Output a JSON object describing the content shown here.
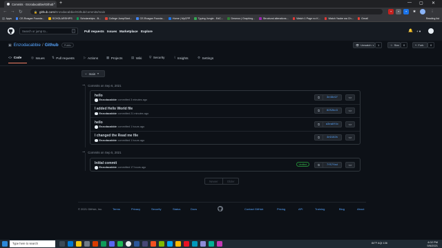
{
  "browser": {
    "tab_title": "Commits · Enzodacabbie/Github",
    "new_tab": "+",
    "url_host": "github.com",
    "url_path": "/Enzodacabbie/Github/commits/main",
    "window_controls": {
      "minimize": "—",
      "maximize": "▢",
      "close": "✕"
    },
    "bookmarks": [
      {
        "label": "Apps",
        "color": "#5f6368"
      },
      {
        "label": "CE-Roagan Founda...",
        "color": "#4285f4"
      },
      {
        "label": "SCHOLARSHIPS",
        "color": "#f4b400"
      },
      {
        "label": "Scholarships - B...",
        "color": "#0f9d58"
      },
      {
        "label": "College JumpStart...",
        "color": "#db4437"
      },
      {
        "label": "CE-Roagan Founda...",
        "color": "#4285f4"
      },
      {
        "label": "Home | MyCPP",
        "color": "#1a73e8"
      },
      {
        "label": "Typing Jungle - EdC...",
        "color": "#34a853"
      },
      {
        "label": "Desmos | Graphing...",
        "color": "#2e7d32"
      },
      {
        "label": "Structural alterations...",
        "color": "#9c27b0"
      },
      {
        "label": "Watch 1 Page no K...",
        "color": "#e53935"
      },
      {
        "label": "Watch Yaube wa Ch...",
        "color": "#e53935"
      },
      {
        "label": "Gmail",
        "color": "#ea4335"
      }
    ],
    "reading_list": "Reading list"
  },
  "github_header": {
    "search_placeholder": "Search or jump to...",
    "search_shortcut": "/",
    "nav": [
      "Pull requests",
      "Issues",
      "Marketplace",
      "Explore"
    ],
    "bell": "🔔",
    "plus": "+ ▾"
  },
  "repo": {
    "owner": "Enzodacabbie",
    "separator": "/",
    "name": "Github",
    "visibility": "Public",
    "unwatch_label": "Unwatch",
    "unwatch_count": "1",
    "star_label": "Star",
    "star_count": "0",
    "fork_label": "Fork",
    "fork_count": "0",
    "tabs": [
      {
        "label": "Code",
        "icon": "<>"
      },
      {
        "label": "Issues",
        "icon": "◎"
      },
      {
        "label": "Pull requests",
        "icon": "⇅"
      },
      {
        "label": "Actions",
        "icon": "▷"
      },
      {
        "label": "Projects",
        "icon": "▦"
      },
      {
        "label": "Wiki",
        "icon": "▤"
      },
      {
        "label": "Security",
        "icon": "⛨"
      },
      {
        "label": "Insights",
        "icon": "⌇"
      },
      {
        "label": "Settings",
        "icon": "⚙"
      }
    ]
  },
  "branch": {
    "label": "main",
    "icon": "⑂",
    "caret": "▾"
  },
  "commit_groups": [
    {
      "heading": "Commits on Sep 6, 2021",
      "commits": [
        {
          "message": "hello",
          "author": "Enzodacabbie",
          "time": "committed 3 minutes ago",
          "sha": "3e48c97",
          "verified": ""
        },
        {
          "message": "I added Hello World file",
          "author": "Enzodacabbie",
          "time": "committed 21 minutes ago",
          "sha": "8252bc3",
          "verified": ""
        },
        {
          "message": "hello",
          "author": "Enzodacabbie",
          "time": "committed 1 hours ago",
          "sha": "a3ea8f4c",
          "verified": ""
        },
        {
          "message": "I changed the Read me file",
          "author": "Enzodacabbie",
          "time": "committed 1 hours ago",
          "sha": "4e9182b",
          "verified": ""
        }
      ]
    },
    {
      "heading": "Commits on Sep 5, 2021",
      "commits": [
        {
          "message": "Initial commit",
          "author": "Enzodacabbie",
          "time": "committed 17 hours ago",
          "sha": "7f57fad",
          "verified": "Verified"
        }
      ]
    }
  ],
  "pagination": {
    "newer": "Newer",
    "older": "Older"
  },
  "footer": {
    "copyright": "© 2021 GitHub, Inc.",
    "links": [
      "Terms",
      "Privacy",
      "Security",
      "Status",
      "Docs",
      "Contact GitHub",
      "Pricing",
      "API",
      "Training",
      "Blog",
      "About"
    ]
  },
  "taskbar": {
    "search_placeholder": "Type here to search",
    "weather": "84°F",
    "aqi": "AQI 136",
    "time": "4:02 PM",
    "date": "9/6/2021"
  },
  "colors": {
    "bg": "#0d1117",
    "header_bg": "#161b22",
    "link": "#58a6ff",
    "tab_active": "#f78166",
    "verified": "#3fb950"
  }
}
